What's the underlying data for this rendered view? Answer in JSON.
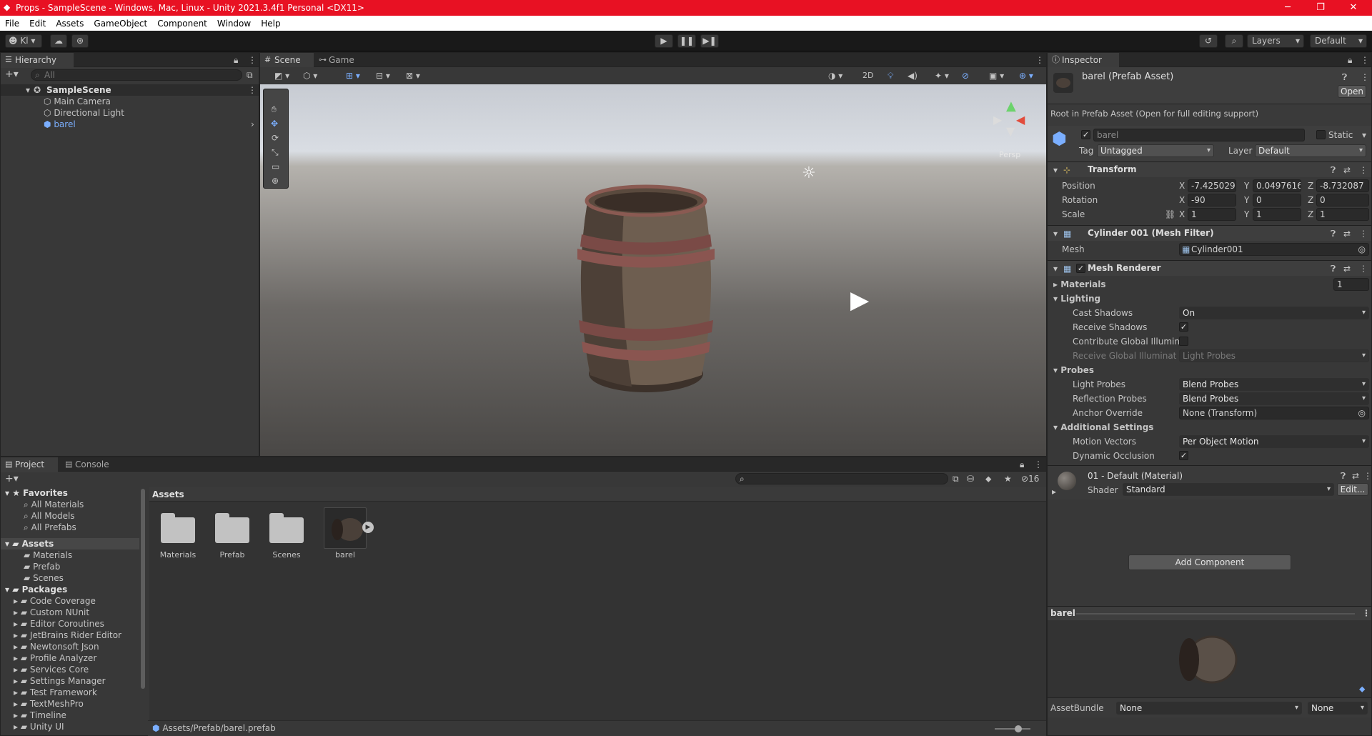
{
  "window": {
    "title": "Props - SampleScene - Windows, Mac, Linux - Unity 2021.3.4f1 Personal <DX11>"
  },
  "menu": [
    "File",
    "Edit",
    "Assets",
    "GameObject",
    "Component",
    "Window",
    "Help"
  ],
  "toolbar": {
    "account": "Kl",
    "layers": "Layers",
    "layout": "Default"
  },
  "hierarchy": {
    "tab": "Hierarchy",
    "search_placeholder": "All",
    "scene": "SampleScene",
    "items": [
      "Main Camera",
      "Directional Light",
      "barel"
    ]
  },
  "scene_view": {
    "tabs": [
      "Scene",
      "Game"
    ],
    "mode_2d": "2D",
    "persp": "Persp"
  },
  "project": {
    "tabs": [
      "Project",
      "Console"
    ],
    "hidden_count": "16",
    "breadcrumb": "Assets",
    "path": "Assets/Prefab/barel.prefab",
    "favorites": {
      "label": "Favorites",
      "items": [
        "All Materials",
        "All Models",
        "All Prefabs"
      ]
    },
    "assets": {
      "label": "Assets",
      "items": [
        "Materials",
        "Prefab",
        "Scenes"
      ]
    },
    "packages": {
      "label": "Packages",
      "items": [
        "Code Coverage",
        "Custom NUnit",
        "Editor Coroutines",
        "JetBrains Rider Editor",
        "Newtonsoft Json",
        "Profile Analyzer",
        "Services Core",
        "Settings Manager",
        "Test Framework",
        "TextMeshPro",
        "Timeline",
        "Unity UI"
      ]
    },
    "grid": [
      "Materials",
      "Prefab",
      "Scenes",
      "barel"
    ]
  },
  "inspector": {
    "tab": "Inspector",
    "title": "barel (Prefab Asset)",
    "open": "Open",
    "note": "Root in Prefab Asset (Open for full editing support)",
    "name": "barel",
    "static": "Static",
    "tag_label": "Tag",
    "tag": "Untagged",
    "layer_label": "Layer",
    "layer": "Default",
    "transform": {
      "title": "Transform",
      "pos_label": "Position",
      "rot_label": "Rotation",
      "scale_label": "Scale",
      "pos": [
        "-7.425029",
        "0.0497616",
        "-8.732087"
      ],
      "rot": [
        "-90",
        "0",
        "0"
      ],
      "scale": [
        "1",
        "1",
        "1"
      ]
    },
    "mesh_filter": {
      "title": "Cylinder 001 (Mesh Filter)",
      "mesh_label": "Mesh",
      "mesh": "Cylinder001"
    },
    "renderer": {
      "title": "Mesh Renderer",
      "materials": "Materials",
      "materials_count": "1",
      "lighting": "Lighting",
      "cast_label": "Cast Shadows",
      "cast": "On",
      "receive_label": "Receive Shadows",
      "contrib_label": "Contribute Global Illuminat",
      "rgi_label": "Receive Global Illuminatio",
      "rgi": "Light Probes",
      "probes": "Probes",
      "lp_label": "Light Probes",
      "lp": "Blend Probes",
      "rp_label": "Reflection Probes",
      "rp": "Blend Probes",
      "anchor_label": "Anchor Override",
      "anchor": "None (Transform)",
      "additional": "Additional Settings",
      "mv_label": "Motion Vectors",
      "mv": "Per Object Motion",
      "occ_label": "Dynamic Occlusion"
    },
    "material": {
      "title": "01 - Default (Material)",
      "shader_label": "Shader",
      "shader": "Standard",
      "edit": "Edit..."
    },
    "add_component": "Add Component",
    "preview_title": "barel",
    "assetbundle": {
      "label": "AssetBundle",
      "name": "None",
      "variant": "None"
    }
  }
}
